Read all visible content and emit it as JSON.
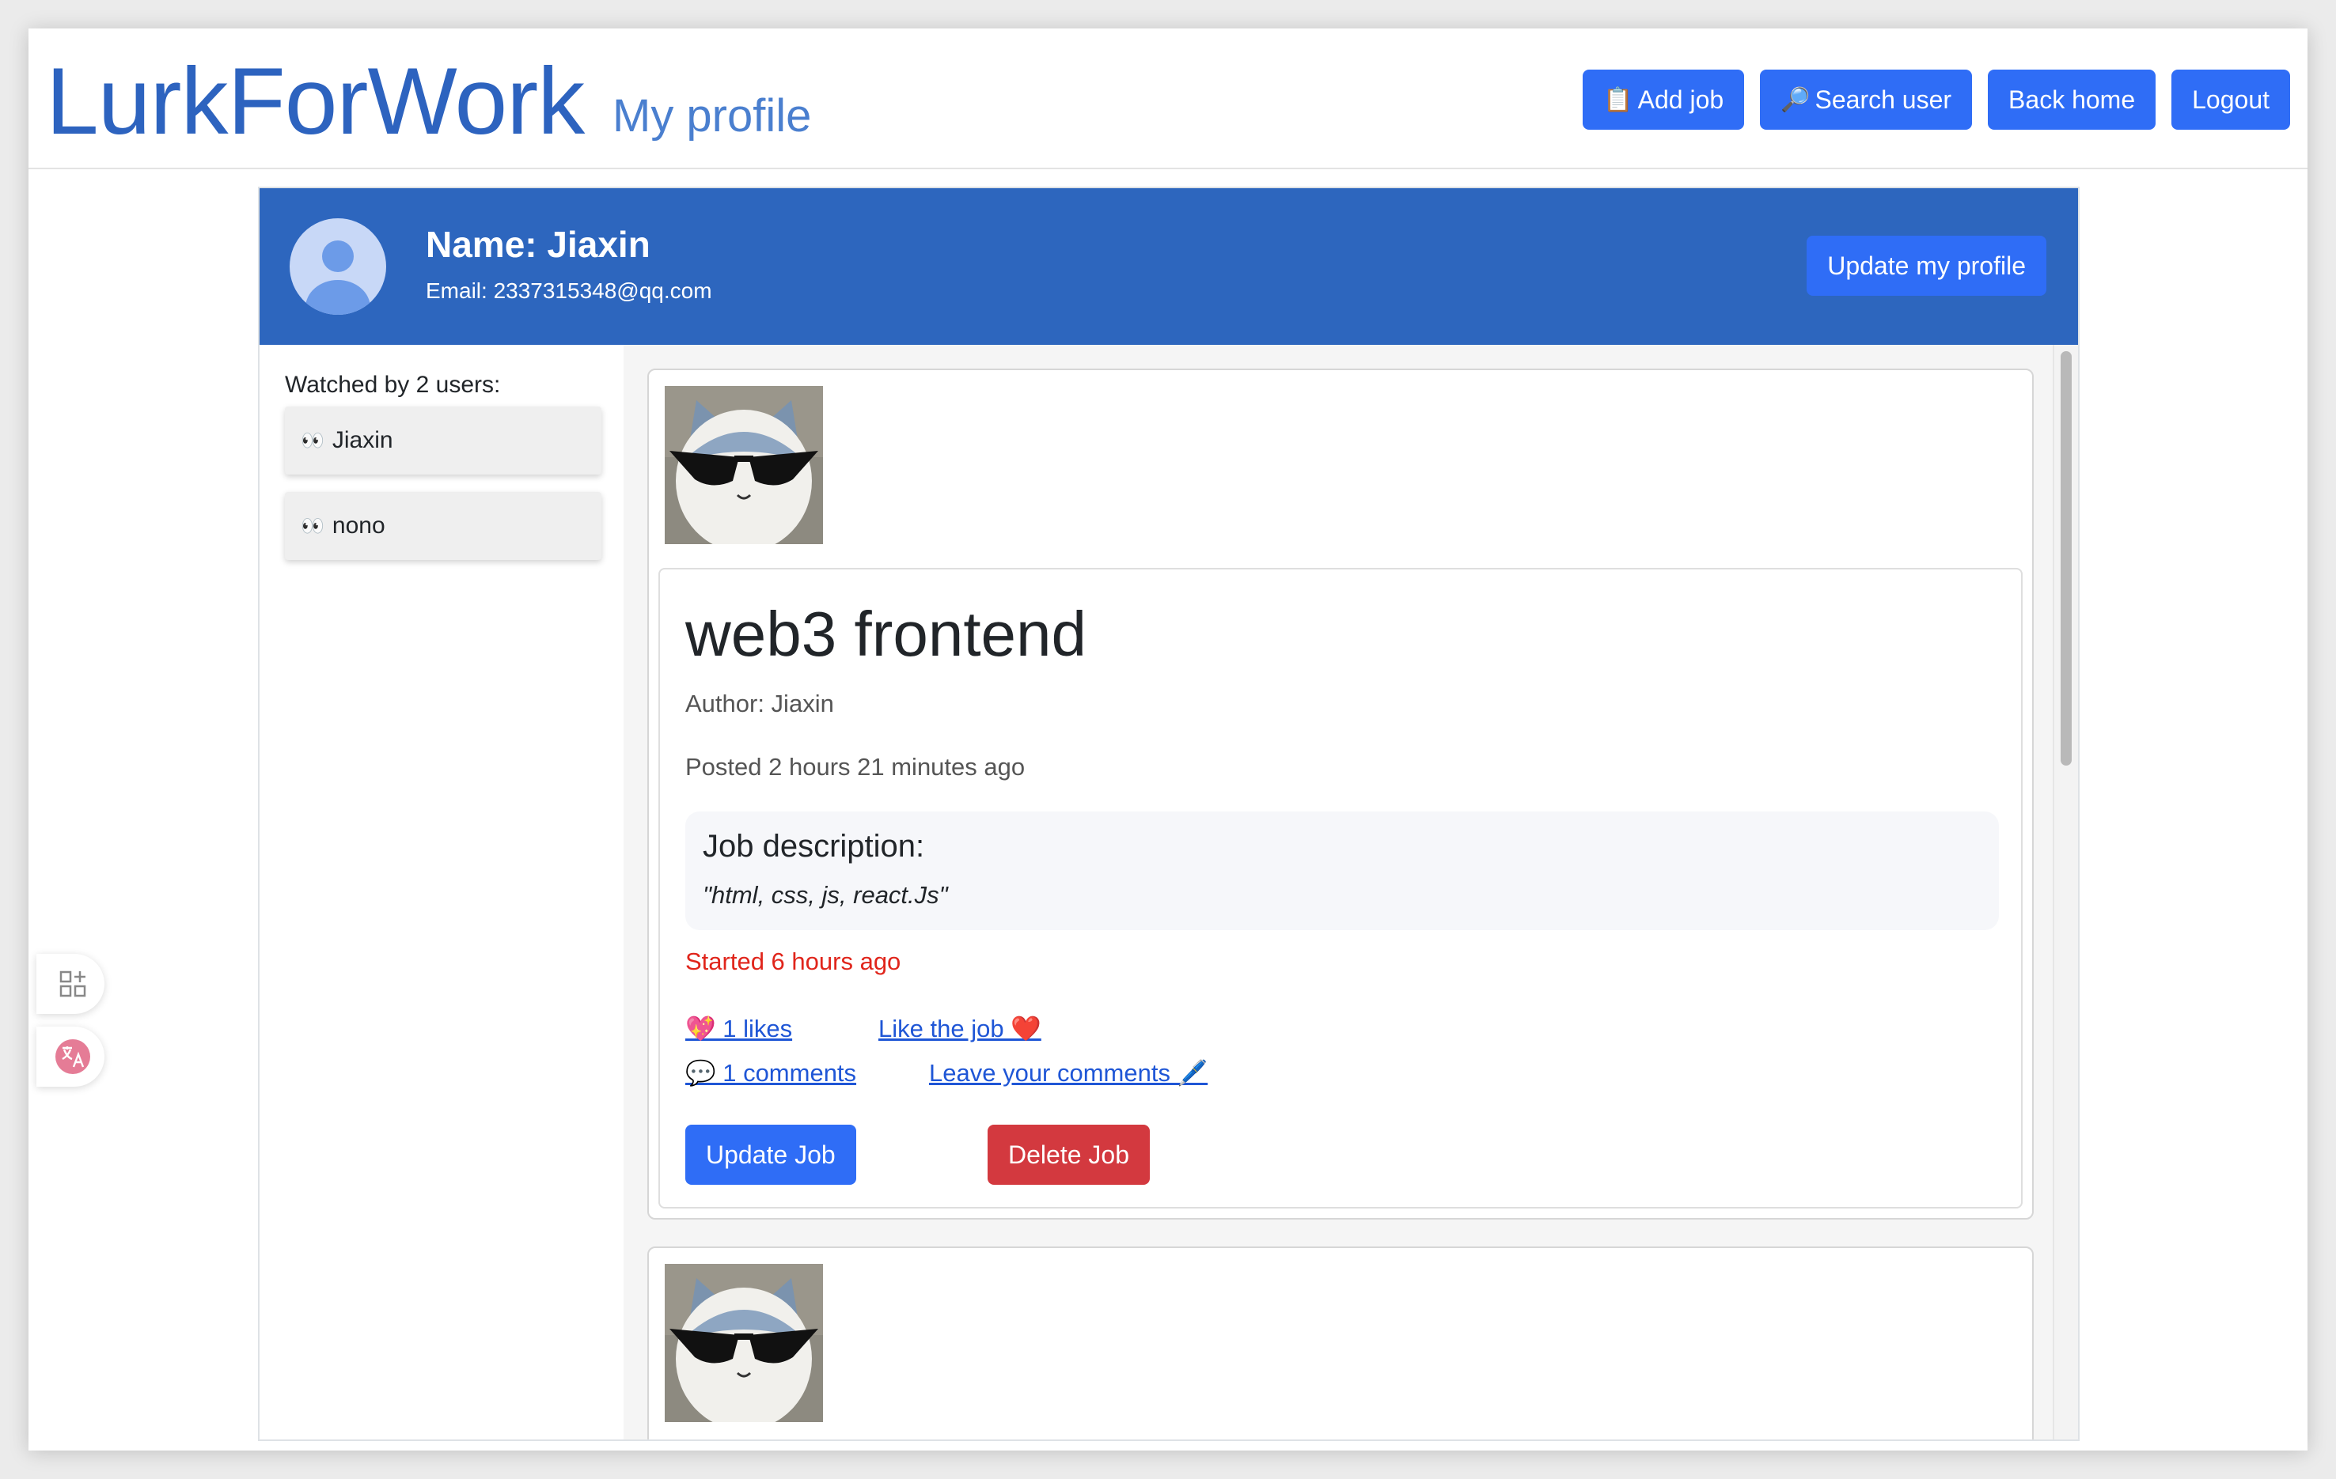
{
  "header": {
    "brand": "LurkForWork",
    "subtitle": "My profile",
    "nav": {
      "add_job": "Add job",
      "add_job_icon": "📋",
      "search_user": "Search user",
      "search_user_icon": "🔎",
      "back_home": "Back home",
      "logout": "Logout"
    }
  },
  "profile": {
    "name": "Name: Jiaxin",
    "email": "Email: 2337315348@qq.com",
    "update_button": "Update my profile"
  },
  "watchers": {
    "title": "Watched by 2 users:",
    "icon": "👀",
    "items": [
      {
        "name": "Jiaxin"
      },
      {
        "name": "nono"
      }
    ]
  },
  "posts": [
    {
      "title": "web3 frontend",
      "author": "Author: Jiaxin",
      "posted": "Posted 2 hours 21 minutes ago",
      "description_heading": "Job description:",
      "description": "\"html, css, js, react.Js\"",
      "started": "Started 6 hours ago",
      "likes_link": "💖 1 likes",
      "like_action": "Like the job ❤️",
      "comments_link": "💬 1 comments",
      "comment_action": "Leave your comments 🖊️",
      "update_button": "Update Job",
      "delete_button": "Delete Job"
    }
  ],
  "colors": {
    "brand": "#2d63bf",
    "primary_button": "#2f6df6",
    "danger_button": "#d3393f",
    "profile_header": "#2d66be",
    "started_text": "#e0251b",
    "link": "#1f56d6"
  }
}
